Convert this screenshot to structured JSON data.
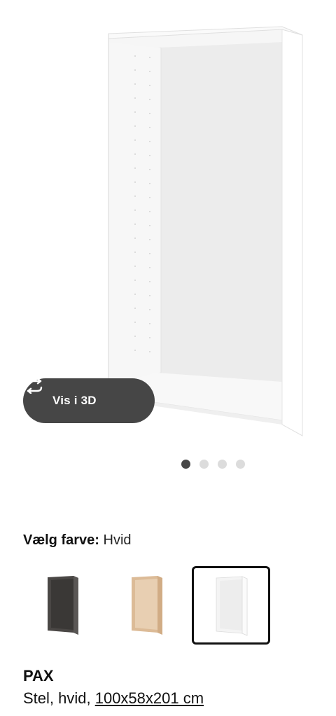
{
  "hero": {
    "view3d_label": "Vis i 3D",
    "carousel": {
      "count": 4,
      "active_index": 0
    }
  },
  "color_selector": {
    "label": "Vælg farve:",
    "selected": "Hvid",
    "options": [
      {
        "name": "Mørkegrå",
        "color": "#4a4745"
      },
      {
        "name": "Hvidbejdset egetræseffekt",
        "color": "#d9b792"
      },
      {
        "name": "Hvid",
        "color": "#ffffff"
      }
    ],
    "selected_index": 2
  },
  "product": {
    "name": "PAX",
    "desc_prefix": "Stel, hvid, ",
    "size_link": "100x58x201 cm"
  }
}
